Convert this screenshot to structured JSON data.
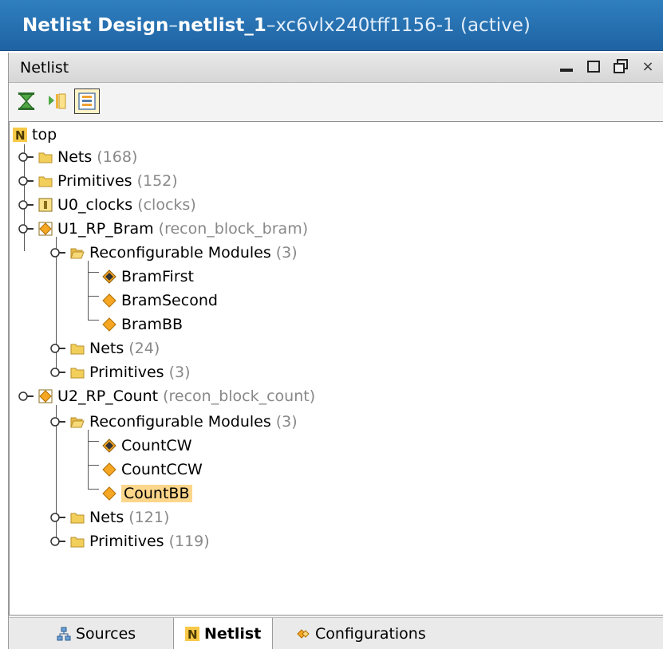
{
  "title": {
    "prefix": "Netlist Design",
    "sep1": " – ",
    "name": "netlist_1",
    "sep2": " – ",
    "part": "xc6vlx240tff1156-1 (active)"
  },
  "panel": {
    "title": "Netlist",
    "controls": {
      "close": "×"
    }
  },
  "toolbar": {
    "buttons": [
      "collapse-all-icon",
      "expand-all-icon",
      "show-selected-icon"
    ]
  },
  "tree": {
    "root": "top",
    "items": [
      {
        "label": "Nets",
        "count": "(168)"
      },
      {
        "label": "Primitives",
        "count": "(152)"
      },
      {
        "label": "U0_clocks",
        "count": "(clocks)"
      },
      {
        "label": "U1_RP_Bram",
        "count": "(recon_block_bram)"
      },
      {
        "label": "Reconfigurable Modules",
        "count": "(3)"
      },
      {
        "label": "BramFirst"
      },
      {
        "label": "BramSecond"
      },
      {
        "label": "BramBB"
      },
      {
        "label": "Nets",
        "count": "(24)"
      },
      {
        "label": "Primitives",
        "count": "(3)"
      },
      {
        "label": "U2_RP_Count",
        "count": "(recon_block_count)"
      },
      {
        "label": "Reconfigurable Modules",
        "count": "(3)"
      },
      {
        "label": "CountCW"
      },
      {
        "label": "CountCCW"
      },
      {
        "label": "CountBB"
      },
      {
        "label": "Nets",
        "count": "(121)"
      },
      {
        "label": "Primitives",
        "count": "(119)"
      }
    ]
  },
  "tabs": {
    "sources": "Sources",
    "netlist": "Netlist",
    "configurations": "Configurations"
  },
  "colors": {
    "title_bg": "#2369a9",
    "selection": "#fcd68a",
    "folder": "#f2cf5b",
    "module": "#f5a623"
  }
}
